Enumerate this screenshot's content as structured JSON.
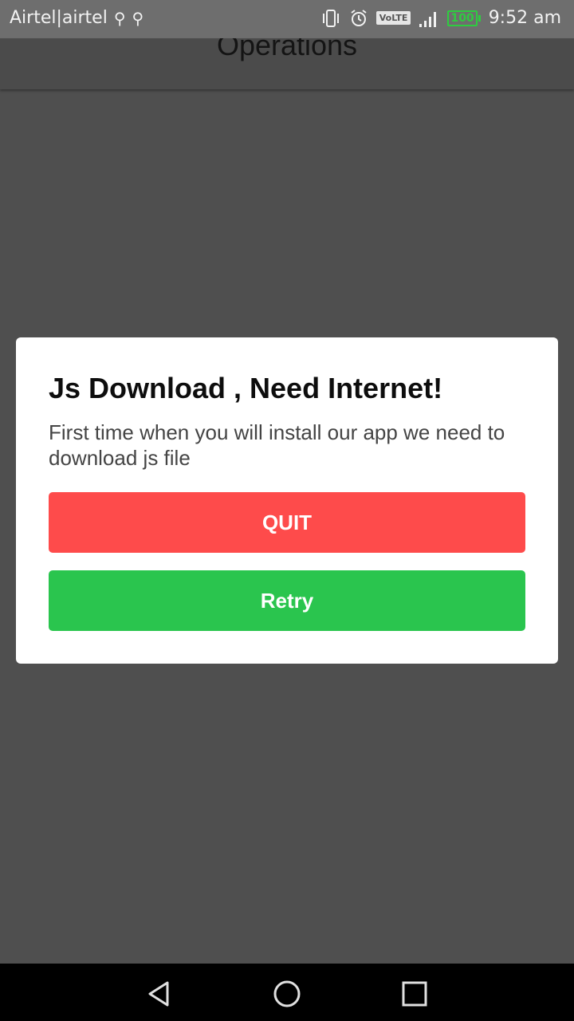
{
  "status_bar": {
    "carrier": "Airtel|airtel",
    "time": "9:52 am",
    "volte_label": "VoLTE",
    "battery": "100",
    "icons": [
      "usb-icon",
      "usb-icon",
      "vibrate-icon",
      "alarm-icon",
      "volte-icon",
      "signal-icon",
      "battery-icon"
    ]
  },
  "app_bar": {
    "title": "Operations"
  },
  "dialog": {
    "title": "Js Download , Need Internet!",
    "message": "First time when you will install our app we need to download js file",
    "quit_label": "QUIT",
    "retry_label": "Retry",
    "quit_color": "#fe4b4b",
    "retry_color": "#2ac54e"
  },
  "nav_bar": {
    "icons": [
      "back-icon",
      "home-icon",
      "recent-apps-icon"
    ]
  }
}
